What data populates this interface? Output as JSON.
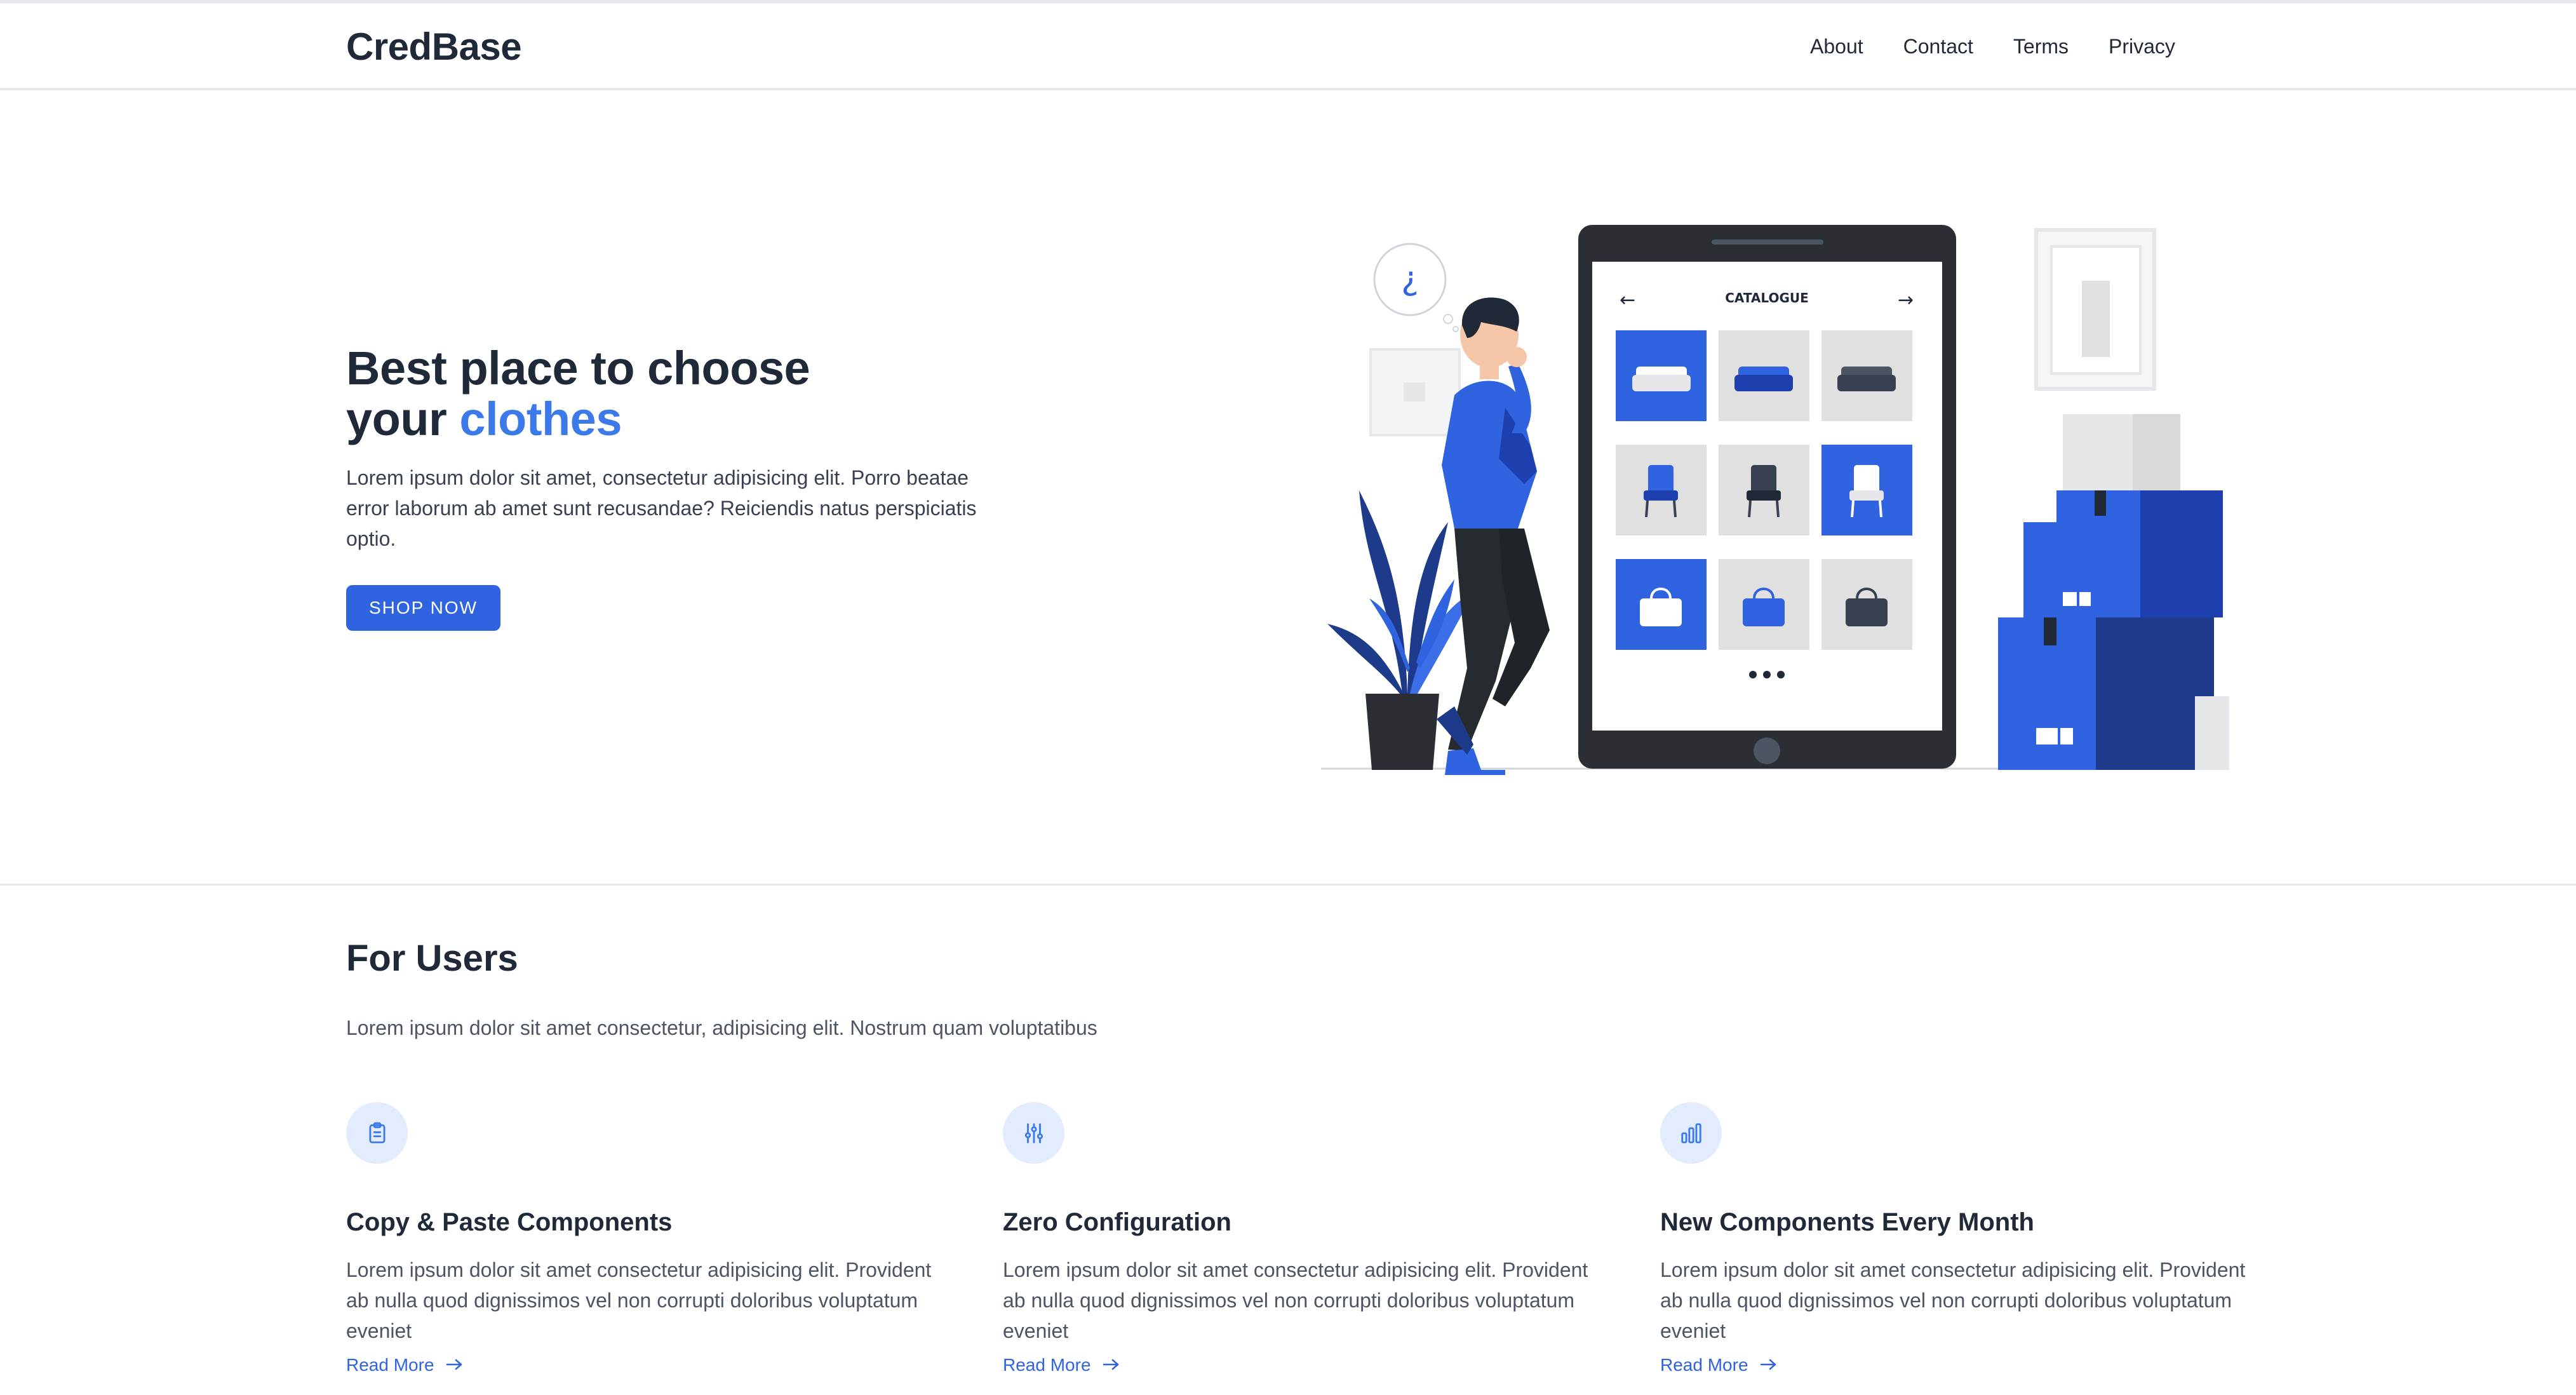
{
  "brand": {
    "name": "CredBase"
  },
  "nav": {
    "links": [
      "About",
      "Contact",
      "Terms",
      "Privacy"
    ]
  },
  "hero": {
    "title_part1": "Best place to choose",
    "title_part2": "your ",
    "title_accent": "clothes",
    "description": "Lorem ipsum dolor sit amet, consectetur adipisicing elit. Porro beatae error laborum ab amet sunt recusandae? Reiciendis natus perspiciatis optio.",
    "cta_label": "SHOP NOW",
    "illustration": {
      "screen_title": "CATALOGUE",
      "thought_glyph": "¿"
    }
  },
  "features_section": {
    "title": "For Users",
    "subtitle": "Lorem ipsum dolor sit amet consectetur, adipisicing elit. Nostrum quam voluptatibus",
    "items": [
      {
        "icon": "clipboard-icon",
        "title": "Copy & Paste Components",
        "description": "Lorem ipsum dolor sit amet consectetur adipisicing elit. Provident ab nulla quod dignissimos vel non corrupti doloribus voluptatum eveniet",
        "link_label": "Read More"
      },
      {
        "icon": "sliders-icon",
        "title": "Zero Configuration",
        "description": "Lorem ipsum dolor sit amet consectetur adipisicing elit. Provident ab nulla quod dignissimos vel non corrupti doloribus voluptatum eveniet",
        "link_label": "Read More"
      },
      {
        "icon": "bar-chart-icon",
        "title": "New Components Every Month",
        "description": "Lorem ipsum dolor sit amet consectetur adipisicing elit. Provident ab nulla quod dignissimos vel non corrupti doloribus voluptatum eveniet",
        "link_label": "Read More"
      }
    ]
  },
  "colors": {
    "accent": "#3b7ae8",
    "button": "#2f63e0",
    "icon_bg": "#e3ecfd",
    "dark_navy": "#1e3a8a",
    "tablet_frame": "#2b2f33"
  }
}
